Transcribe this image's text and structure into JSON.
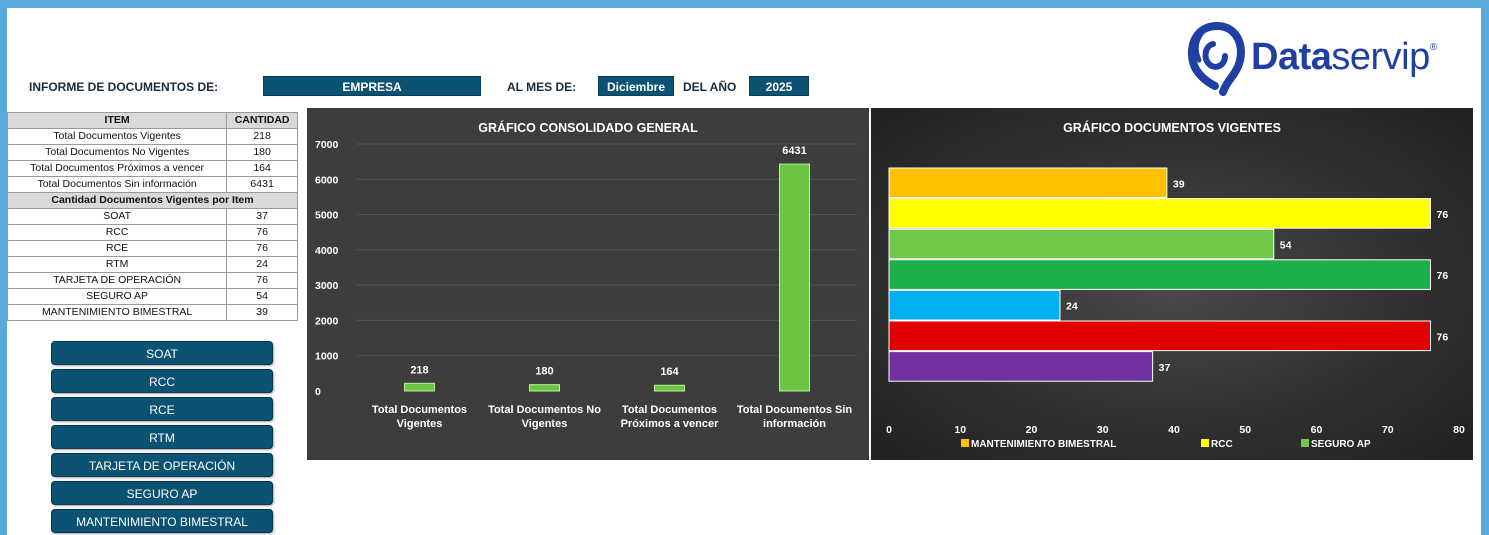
{
  "header": {
    "informe_label": "INFORME DE DOCUMENTOS DE:",
    "empresa_value": "EMPRESA",
    "mes_label": "AL MES DE:",
    "mes_value": "Diciembre",
    "anio_label": "DEL AÑO",
    "anio_value": "2025"
  },
  "logo": {
    "text_bold": "Data",
    "text_regular": "servip",
    "mark": "®",
    "color": "#1f3fa3"
  },
  "table": {
    "headers": [
      "ITEM",
      "CANTIDAD"
    ],
    "summary_rows": [
      {
        "item": "Total Documentos Vigentes",
        "qty": "218"
      },
      {
        "item": "Total Documentos No Vigentes",
        "qty": "180"
      },
      {
        "item": "Total Documentos Próximos a vencer",
        "qty": "164"
      },
      {
        "item": "Total Documentos Sin información",
        "qty": "6431"
      }
    ],
    "section_title": "Cantidad Documentos Vigentes por Item",
    "item_rows": [
      {
        "item": "SOAT",
        "qty": "37"
      },
      {
        "item": "RCC",
        "qty": "76"
      },
      {
        "item": "RCE",
        "qty": "76"
      },
      {
        "item": "RTM",
        "qty": "24"
      },
      {
        "item": "TARJETA DE OPERACIÓN",
        "qty": "76"
      },
      {
        "item": "SEGURO AP",
        "qty": "54"
      },
      {
        "item": "MANTENIMIENTO BIMESTRAL",
        "qty": "39"
      }
    ]
  },
  "nav_buttons": [
    "SOAT",
    "RCC",
    "RCE",
    "RTM",
    "TARJETA DE OPERACIÓN",
    "SEGURO AP",
    "MANTENIMIENTO BIMESTRAL"
  ],
  "chart_data": [
    {
      "type": "bar",
      "title": "GRÁFICO CONSOLIDADO GENERAL",
      "categories": [
        [
          "Total Documentos",
          "Vigentes"
        ],
        [
          "Total Documentos No",
          "Vigentes"
        ],
        [
          "Total Documentos",
          "Próximos a vencer"
        ],
        [
          "Total Documentos Sin",
          "información"
        ]
      ],
      "values": [
        218,
        180,
        164,
        6431
      ],
      "ylim": [
        0,
        7000
      ],
      "yticks": [
        0,
        1000,
        2000,
        3000,
        4000,
        5000,
        6000,
        7000
      ],
      "bar_color": "#6cc644",
      "grid": true
    },
    {
      "type": "bar",
      "orientation": "horizontal",
      "title": "GRÁFICO DOCUMENTOS VIGENTES",
      "values": [
        39,
        76,
        54,
        76,
        24,
        76,
        37
      ],
      "colors": [
        "#ffc000",
        "#ffff00",
        "#70c94a",
        "#1db04a",
        "#00b0f0",
        "#e00000",
        "#7030a0"
      ],
      "xlim": [
        0,
        80
      ],
      "xticks": [
        0,
        10,
        20,
        30,
        40,
        50,
        60,
        70,
        80
      ],
      "legend": [
        {
          "name": "MANTENIMIENTO BIMESTRAL",
          "color": "#ffc000"
        },
        {
          "name": "RCC",
          "color": "#ffff00"
        },
        {
          "name": "SEGURO AP",
          "color": "#70c94a"
        }
      ],
      "legend_position": "bottom"
    }
  ]
}
